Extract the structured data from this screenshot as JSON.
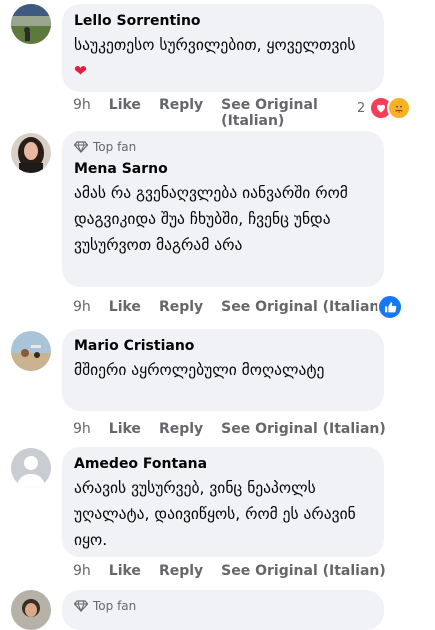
{
  "comments": [
    {
      "author": "Lello Sorrentino",
      "text": "საუკეთესო სურვილებით, ყოველთვის",
      "emoji": "❤",
      "time": "9h",
      "like": "Like",
      "reply": "Reply",
      "see_original": "See Original",
      "see_original_lang": "(Italian)",
      "reaction_count": "2"
    },
    {
      "badge": "Top fan",
      "author": "Mena Sarno",
      "text": "ამას რა გვენაღვლება იანვარში რომ დაგვიკიდა შუა ჩხუბში, ჩვენც უნდა ვუსურვოთ მაგრამ არა",
      "time": "9h",
      "like": "Like",
      "reply": "Reply",
      "see_original": "See Original (Italian)"
    },
    {
      "author": "Mario Cristiano",
      "text": "მშიერი აყროლებული მოღალატე",
      "time": "9h",
      "like": "Like",
      "reply": "Reply",
      "see_original": "See Original (Italian)"
    },
    {
      "author": "Amedeo Fontana",
      "text": "არავის ვუსურვებ, ვინც ნეაპოლს უღალატა, დაივიწყოს, რომ ეს არავინ იყო.",
      "time": "9h",
      "like": "Like",
      "reply": "Reply",
      "see_original": "See Original (Italian)"
    },
    {
      "badge": "Top fan"
    }
  ],
  "colors": {
    "bubble": "#f0f2f5",
    "meta": "#65676b",
    "like_blue": "#1877f2",
    "heart_red": "#f33e58",
    "care_yellow": "#f7b125"
  }
}
